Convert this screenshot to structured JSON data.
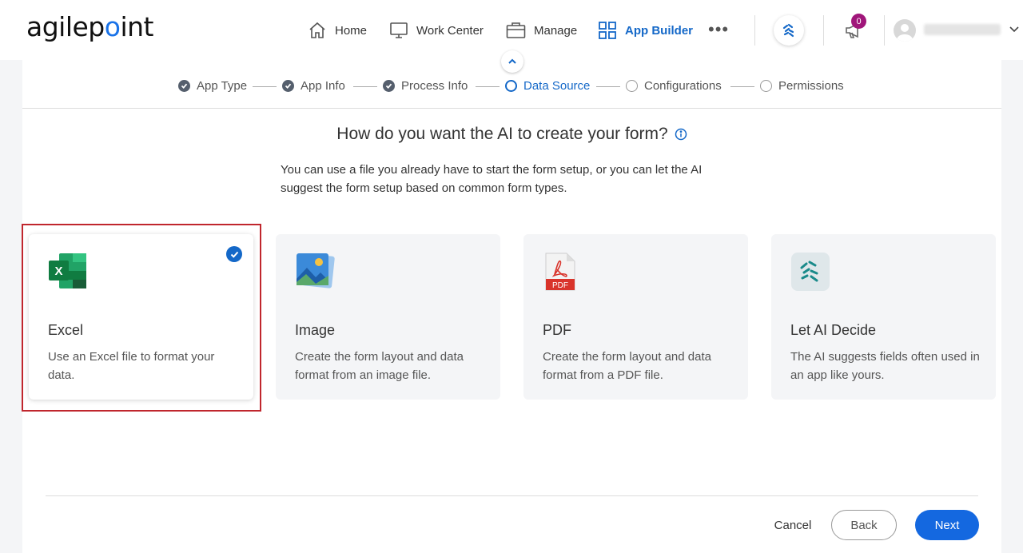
{
  "header": {
    "logo": {
      "part1": "agilep",
      "part2": "int"
    },
    "nav": [
      {
        "label": "Home",
        "icon": "home-icon"
      },
      {
        "label": "Work Center",
        "icon": "monitor-icon"
      },
      {
        "label": "Manage",
        "icon": "briefcase-icon"
      },
      {
        "label": "App Builder",
        "icon": "grid-icon",
        "active": true
      }
    ],
    "more": "•••",
    "notification_count": "0"
  },
  "stepper": {
    "steps": [
      {
        "label": "App Type",
        "state": "done"
      },
      {
        "label": "App Info",
        "state": "done"
      },
      {
        "label": "Process Info",
        "state": "done"
      },
      {
        "label": "Data Source",
        "state": "current"
      },
      {
        "label": "Configurations",
        "state": "todo"
      },
      {
        "label": "Permissions",
        "state": "todo"
      }
    ]
  },
  "main": {
    "title": "How do you want the AI to create your form?",
    "description_line1": "You can use a file you already have to start the form setup, or you can let the AI",
    "description_line2": "suggest the form setup based on common form types."
  },
  "cards": [
    {
      "title": "Excel",
      "description": "Use an Excel file to format your data.",
      "icon": "excel-icon",
      "selected": true
    },
    {
      "title": "Image",
      "description": "Create the form layout and data format from an image file.",
      "icon": "image-icon"
    },
    {
      "title": "PDF",
      "description": "Create the form layout and data format from a PDF file.",
      "icon": "pdf-icon",
      "icon_text": "PDF"
    },
    {
      "title": "Let AI Decide",
      "description": "The AI suggests fields often used in an app like yours.",
      "icon": "ai-icon"
    }
  ],
  "footer": {
    "cancel": "Cancel",
    "back": "Back",
    "next": "Next"
  },
  "colors": {
    "accent": "#1468c8",
    "highlight": "#c0262d",
    "badge": "#a0167a"
  }
}
